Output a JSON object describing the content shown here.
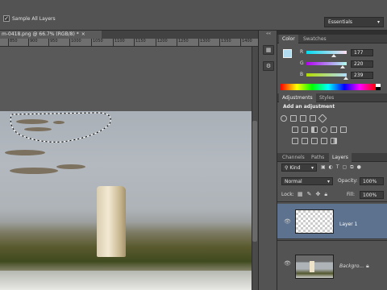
{
  "options_bar": {
    "sample_all_layers_label": "Sample All Layers",
    "sample_all_layers_checked": true,
    "workspace_label": "Essentials"
  },
  "document": {
    "tab_title": "m-0418.png @ 66.7% (RGB/8) *",
    "ruler_ticks": [
      "850",
      "900",
      "950",
      "1000",
      "1050",
      "1100",
      "1150",
      "1200",
      "1250",
      "1300",
      "1350",
      "1400"
    ]
  },
  "color_panel": {
    "tabs": [
      "Color",
      "Swatches"
    ],
    "channels": [
      {
        "label": "R",
        "value": "177"
      },
      {
        "label": "G",
        "value": "220"
      },
      {
        "label": "B",
        "value": "239"
      }
    ],
    "foreground_color": "#b1dcef"
  },
  "adjustments_panel": {
    "tabs": [
      "Adjustments",
      "Styles"
    ],
    "title": "Add an adjustment"
  },
  "layers_panel": {
    "tabs": [
      "Channels",
      "Paths",
      "Layers"
    ],
    "filter_kind": "Kind",
    "blend_mode": "Normal",
    "opacity_label": "Opacity:",
    "opacity_value": "100%",
    "lock_label": "Lock:",
    "fill_label": "Fill:",
    "fill_value": "100%",
    "layers": [
      {
        "name": "Layer 1",
        "selected": true
      },
      {
        "name": "Backgro...",
        "selected": false
      }
    ]
  }
}
